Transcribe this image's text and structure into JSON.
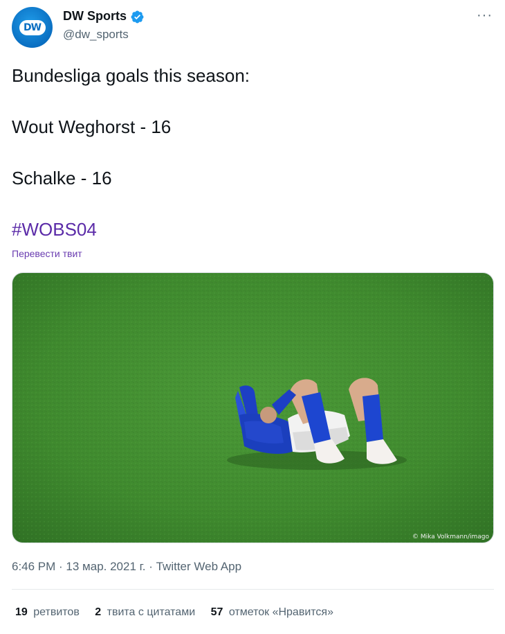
{
  "author": {
    "display_name": "DW Sports",
    "handle": "@dw_sports",
    "avatar_text": "DW",
    "verified": true
  },
  "tweet": {
    "line1": "Bundesliga goals this season:",
    "line2": "Wout Weghorst - 16",
    "line3": "Schalke - 16",
    "hashtag": "#WOBS04",
    "translate_label": "Перевести твит"
  },
  "media": {
    "photo_credit": "© Mika Volkmann/imago"
  },
  "meta": {
    "timestamp": "6:46 PM · 13 мар. 2021 г. · Twitter Web App"
  },
  "stats": [
    {
      "count": "19",
      "label": "ретвитов"
    },
    {
      "count": "2",
      "label": "твита с цитатами"
    },
    {
      "count": "57",
      "label": "отметок «Нравится»"
    }
  ],
  "colors": {
    "text": "#0f1419",
    "secondary": "#536471",
    "hashtag": "#5b2ba8",
    "verified": "#1d9bf0",
    "avatar": "#0a6fc2",
    "grass": "#3f8a2e"
  },
  "icons": {
    "more": "more-horizontal-icon",
    "verified": "verified-badge-icon"
  }
}
